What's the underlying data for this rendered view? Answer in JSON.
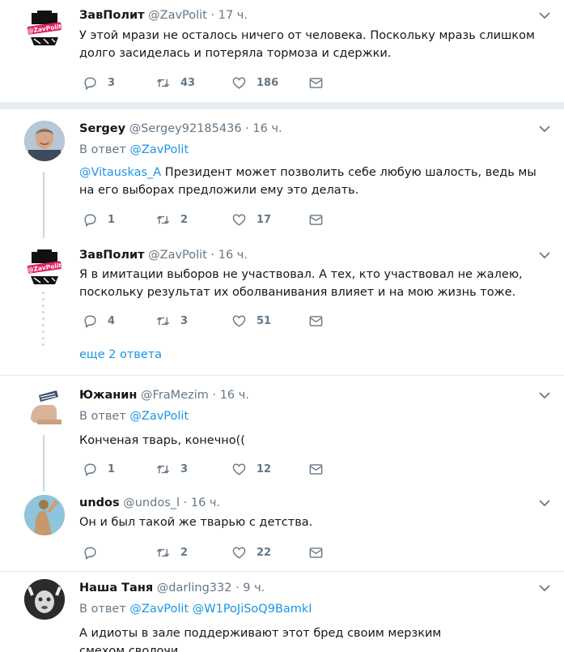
{
  "tweets": [
    {
      "name": "ЗавПолит",
      "handle": "@ZavPolit",
      "time": "17 ч.",
      "reply_prefix": "",
      "reply_to": "",
      "mention": "",
      "text": "У этой мрази не осталось ничего от человека. Поскольку мразь слишком долго засиделась и потеряла тормоза и сдержки.",
      "replies": "3",
      "retweets": "43",
      "likes": "186",
      "avatar_label": "@ZavPolit"
    },
    {
      "name": "Sergey",
      "handle": "@Sergey92185436",
      "time": "16 ч.",
      "reply_prefix": "В ответ",
      "reply_to": "@ZavPolit",
      "mention": "@Vitauskas_A",
      "text": " Президент может позволить себе любую шалость, ведь мы на его выборах предложили ему это делать.",
      "replies": "1",
      "retweets": "2",
      "likes": "17",
      "avatar_label": ""
    },
    {
      "name": "ЗавПолит",
      "handle": "@ZavPolit",
      "time": "16 ч.",
      "reply_prefix": "",
      "reply_to": "",
      "mention": "",
      "text": "Я в имитации выборов не участвовал. А тех, кто участвовал не жалею, поскольку результат их оболванивания влияет и на мою жизнь тоже.",
      "replies": "4",
      "retweets": "3",
      "likes": "51",
      "avatar_label": "@ZavPolit"
    },
    {
      "name": "Южанин",
      "handle": "@FraMezim",
      "time": "16 ч.",
      "reply_prefix": "В ответ",
      "reply_to": "@ZavPolit",
      "mention": "",
      "text": "Конченая тварь, конечно((",
      "replies": "1",
      "retweets": "3",
      "likes": "12",
      "avatar_label": ""
    },
    {
      "name": "undos",
      "handle": "@undos_l",
      "time": "16 ч.",
      "reply_prefix": "",
      "reply_to": "",
      "mention": "",
      "text": "Он и был такой же тварью с детства.",
      "replies": "",
      "retweets": "2",
      "likes": "22",
      "avatar_label": ""
    },
    {
      "name": "Наша Таня",
      "handle": "@darling332",
      "time": "9 ч.",
      "reply_prefix": "В ответ",
      "reply_to": "@ZavPolit @W1PoJiSoQ9BamkI",
      "mention": "",
      "text": "А идиоты в зале поддерживают этот бред своим мерзким смехом,сволочи",
      "replies": "",
      "retweets": "",
      "likes": "",
      "avatar_label": ""
    }
  ],
  "more_replies": "еще 2 ответа",
  "dot_separator": "·",
  "icons": {
    "reply": "reply-icon",
    "retweet": "retweet-icon",
    "like": "heart-icon",
    "dm": "envelope-icon",
    "menu": "chevron-down-icon"
  },
  "colors": {
    "link": "#1b95e0",
    "muted": "#657786",
    "text": "#14171a",
    "line": "#ccd6dd"
  }
}
